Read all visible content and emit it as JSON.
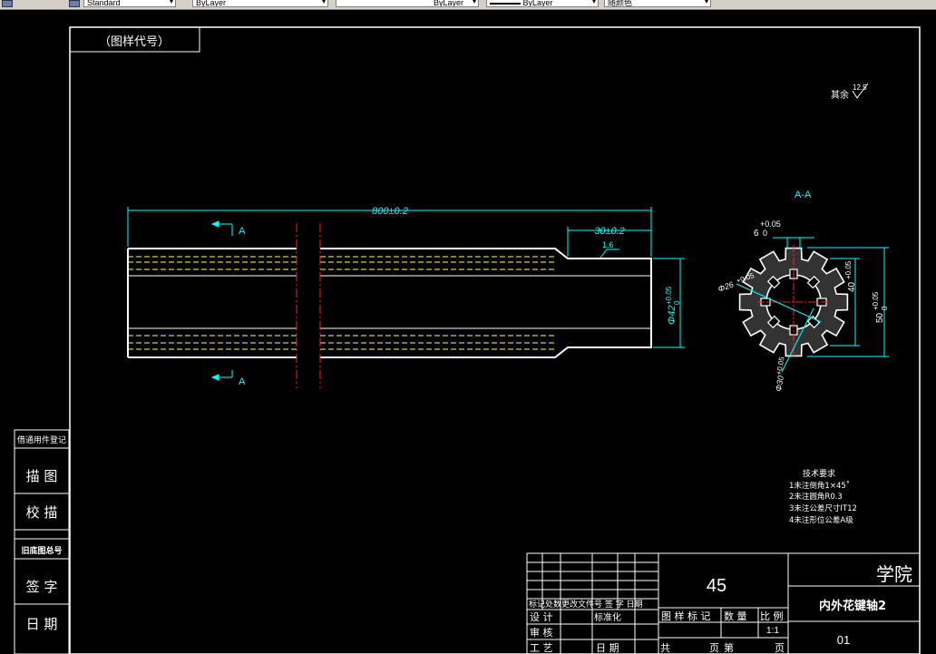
{
  "toolbar": {
    "style_value": "Standard",
    "layer_value": "ByLayer",
    "linetype_value": "ByLayer",
    "lineweight_value": "ByLayer",
    "color_value": "随颜色"
  },
  "drawing": {
    "stamp_label": "（图样代号）",
    "roughness_label": "其余",
    "roughness_value": "12.5",
    "dim_total_length": "800±0.2",
    "dim_step_length": "30±0.2",
    "roughness_local": "1.6",
    "dim_shaft_dia": "Φ42",
    "dim_shaft_tol": "+0.05",
    "dim_shaft_tol_low": "0",
    "section_label_top": "A",
    "section_label_bottom": "A",
    "section_view_title": "A-A",
    "dim_key_width": "6",
    "dim_key_tol": "+0.05",
    "dim_key_tol_low": "0",
    "dim_inner_dia": "Φ26",
    "dim_inner_tol": "+0.05",
    "dim_depth": "40",
    "dim_depth_tol": "+0.05",
    "dim_outer": "50",
    "dim_outer_tol": "+0.05",
    "dim_outer_tol_low": "0",
    "dim_bottom": "Φ30",
    "dim_bottom_tol": "+0.05"
  },
  "tech_req": {
    "title": "技术要求",
    "items": [
      "1未注倒角1×45˚",
      "2未注圆角R0.3",
      "3未注公差尺寸IT12",
      "4未注形位公差A级"
    ]
  },
  "side_panel": {
    "row1": "借通用件登记",
    "row2": "描  图",
    "row3": "校  描",
    "row4": "旧底图总号",
    "row5": "签  字",
    "row6": "日  期"
  },
  "title_block": {
    "material": "45",
    "school": "学院",
    "part_name": "内外花键轴2",
    "drawing_no": "01",
    "rev_header": "标记处数更改文件号 签 字 日期",
    "design": "设 计",
    "standardize": "标准化",
    "review": "审 核",
    "process": "工 艺",
    "date": "日 期",
    "stage_mark": "图 样 标 记",
    "weight": "数 量",
    "scale": "比 例",
    "scale_value": "1:1",
    "total": "共",
    "page": "页",
    "sheet": "第",
    "sheet_page": "页"
  }
}
